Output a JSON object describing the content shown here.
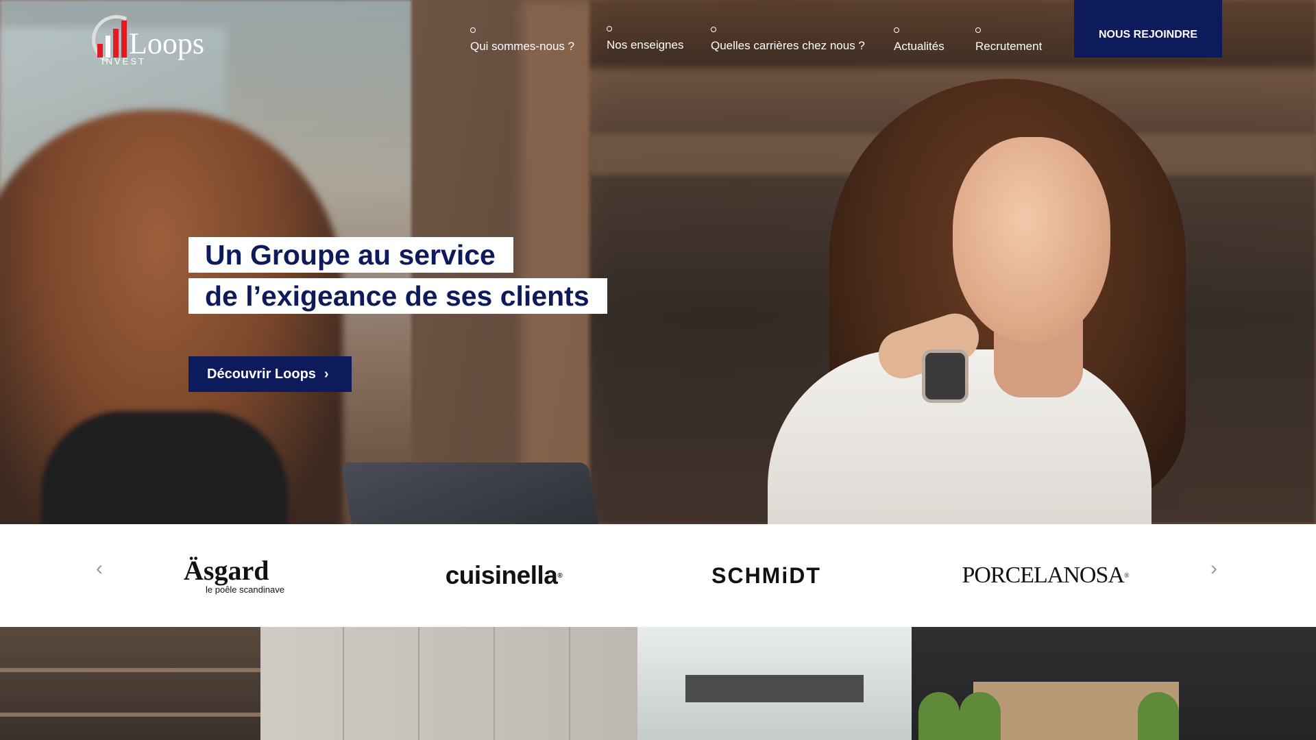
{
  "brand": {
    "logo_word": "Loops",
    "logo_sub": "INVEST",
    "red": "#e21b23",
    "navy": "#0d1a5c"
  },
  "nav": {
    "items": [
      {
        "label": "Qui sommes-nous ?"
      },
      {
        "label": "Nos enseignes"
      },
      {
        "label": "Quelles carrières chez nous ?"
      },
      {
        "label": "Actualités"
      },
      {
        "label": "Recrutement"
      }
    ],
    "join_label": "NOUS REJOINDRE"
  },
  "hero": {
    "line1": "Un Groupe au service",
    "line2": "de l’exigeance de ses clients",
    "cta_label": "Découvrir Loops",
    "cta_icon": "chevron-right-icon"
  },
  "brands": {
    "prev_icon": "chevron-left-icon",
    "next_icon": "chevron-right-icon",
    "items": [
      {
        "name": "Äsgard",
        "tagline": "le poêle scandinave"
      },
      {
        "name": "cuisinella"
      },
      {
        "name": "SCHMiDT"
      },
      {
        "name": "PORCELANOSA"
      }
    ]
  }
}
